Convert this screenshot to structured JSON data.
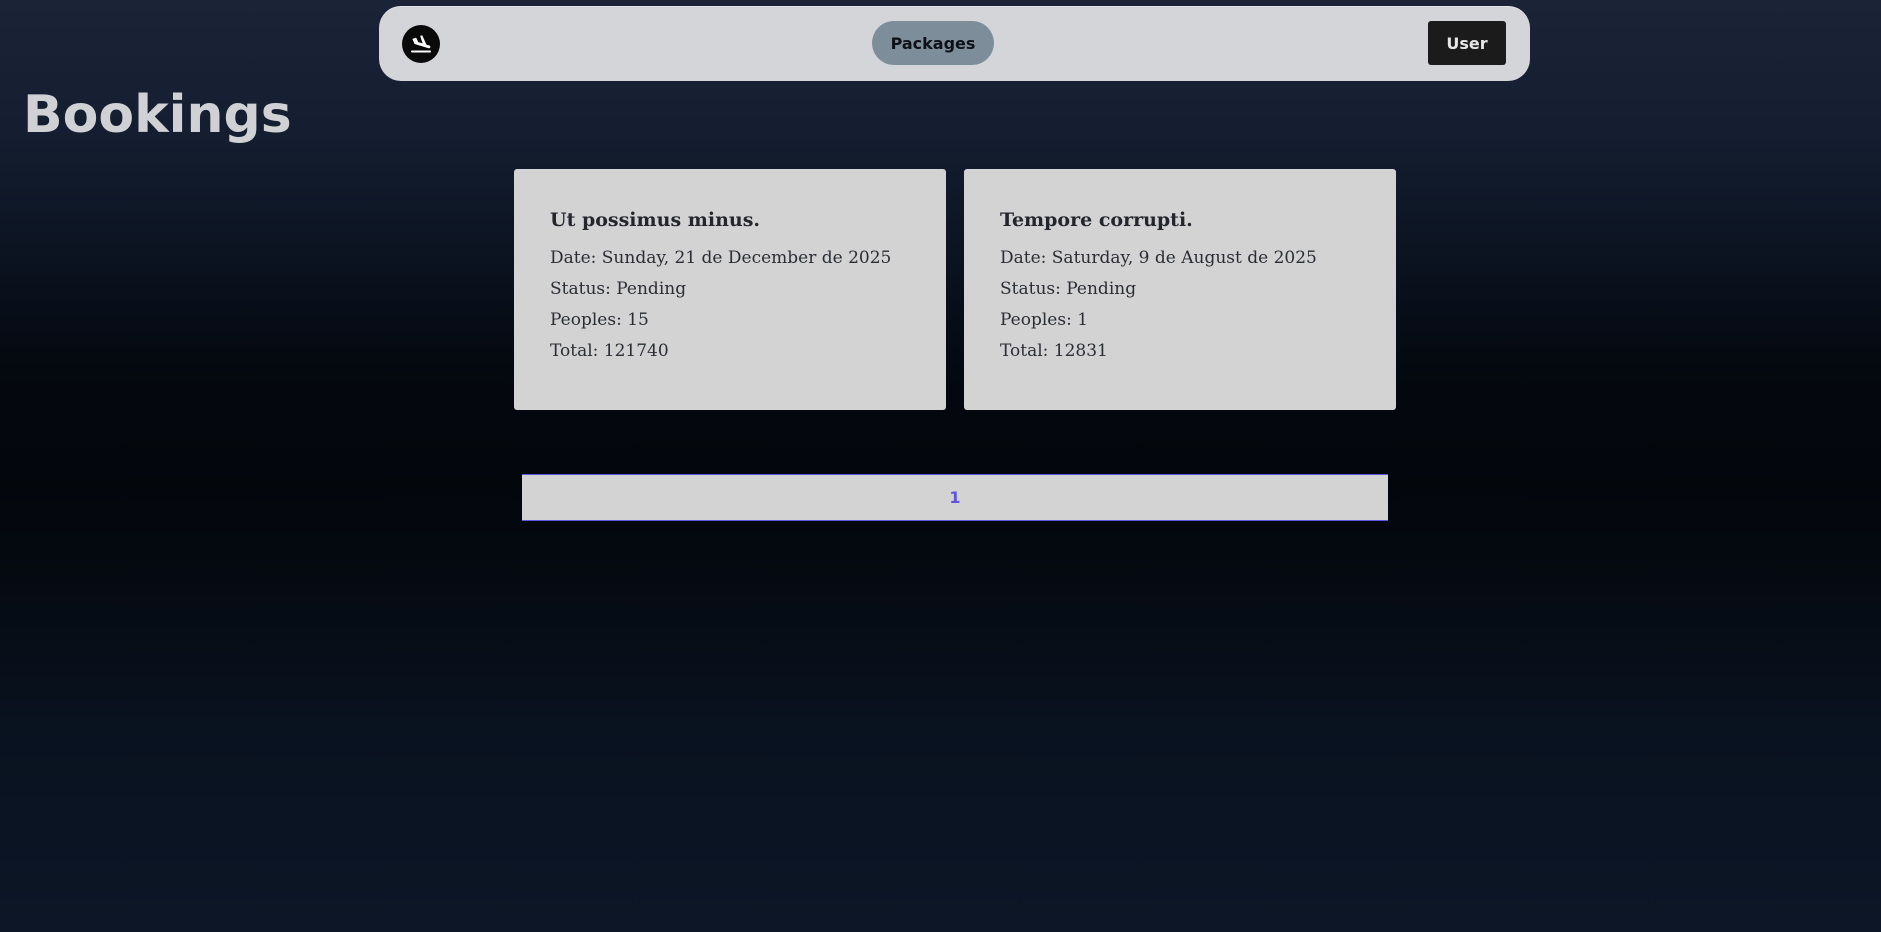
{
  "navbar": {
    "logo_icon": "plane-landing-icon",
    "nav_link_label": "Packages",
    "user_button_label": "User"
  },
  "page": {
    "title": "Bookings"
  },
  "bookings": [
    {
      "title": "Ut possimus minus.",
      "date": "Date: Sunday, 21 de December de 2025",
      "status": "Status: Pending",
      "peoples": "Peoples: 15",
      "total": "Total: 121740"
    },
    {
      "title": "Tempore corrupti.",
      "date": "Date: Saturday, 9 de August de 2025",
      "status": "Status: Pending",
      "peoples": "Peoples: 1",
      "total": "Total: 12831"
    }
  ],
  "pagination": {
    "pages": [
      "1"
    ],
    "current": "1"
  },
  "colors": {
    "navbar_bg": "#d3d5d9",
    "nav_pill_bg": "#7d8e9a",
    "user_button_bg": "#1b1b1b",
    "card_bg": "#d3d3d4",
    "pagination_accent": "#5b55e0",
    "title_text": "#cfd1d4"
  }
}
